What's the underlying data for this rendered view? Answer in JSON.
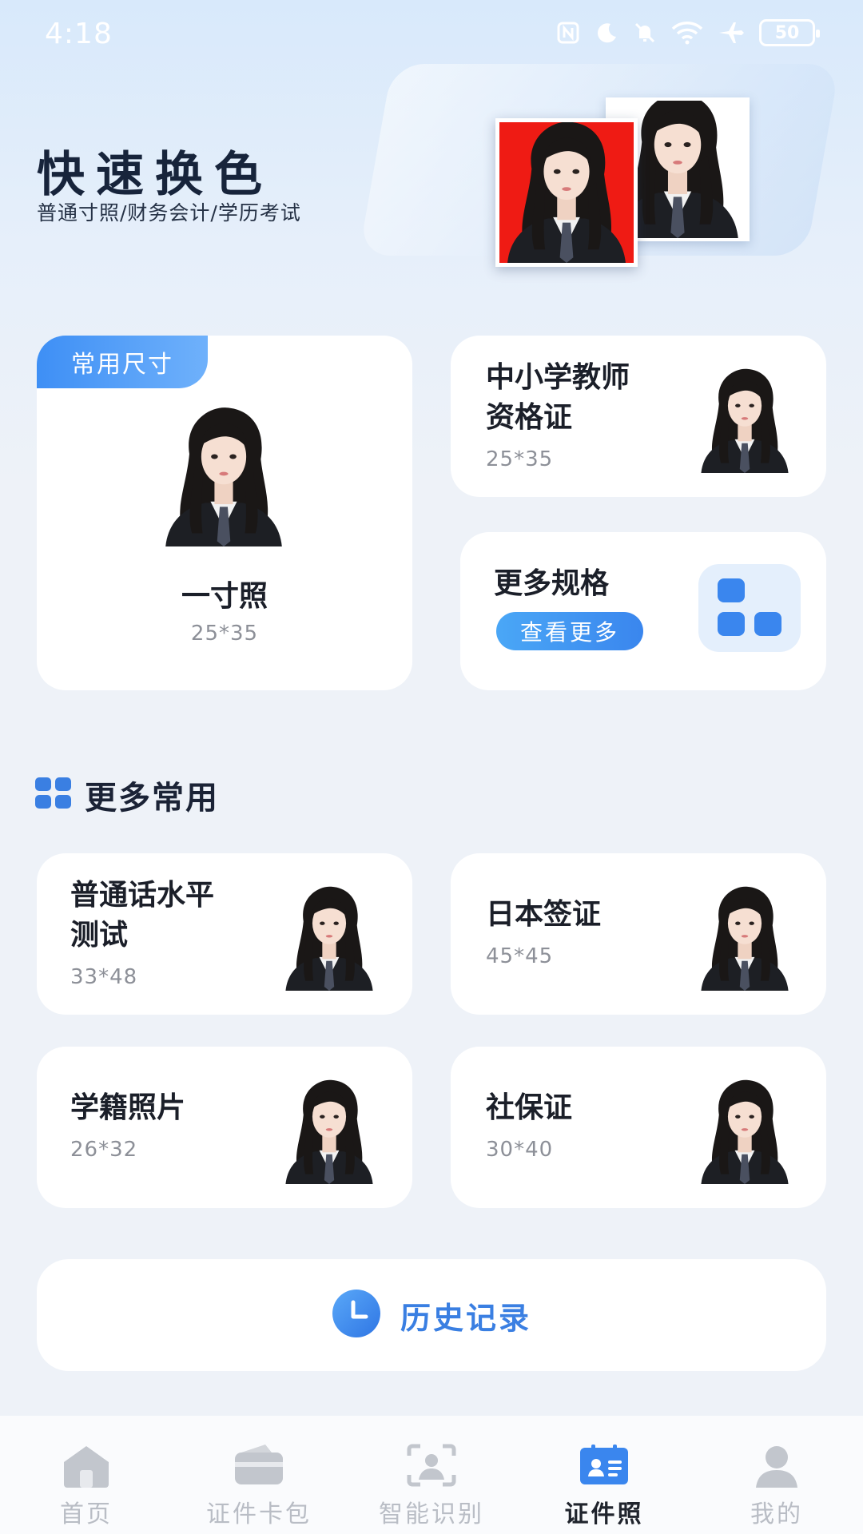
{
  "status_bar": {
    "time": "4:18",
    "battery": "50"
  },
  "hero": {
    "title": "快速换色",
    "subtitle": "普通寸照/财务会计/学历考试"
  },
  "featured": {
    "tag": "常用尺寸",
    "title": "一寸照",
    "size": "25*35"
  },
  "teacher_card": {
    "title_line1": "中小学教师",
    "title_line2": "资格证",
    "size": "25*35"
  },
  "more_specs_card": {
    "title": "更多规格",
    "button": "查看更多"
  },
  "section": {
    "title": "更多常用"
  },
  "items": [
    {
      "title_line1": "普通话水平",
      "title_line2": "测试",
      "size": "33*48"
    },
    {
      "title_line1": "日本签证",
      "title_line2": "",
      "size": "45*45"
    },
    {
      "title_line1": "学籍照片",
      "title_line2": "",
      "size": "26*32"
    },
    {
      "title_line1": "社保证",
      "title_line2": "",
      "size": "30*40"
    }
  ],
  "history": {
    "label": "历史记录"
  },
  "nav": {
    "home": "首页",
    "wallet": "证件卡包",
    "recognize": "智能识别",
    "idphoto": "证件照",
    "mine": "我的"
  },
  "colors": {
    "accent": "#3a86ee",
    "hero_red_bg": "#ef1b14",
    "nav_inactive": "#b9bdc5"
  }
}
